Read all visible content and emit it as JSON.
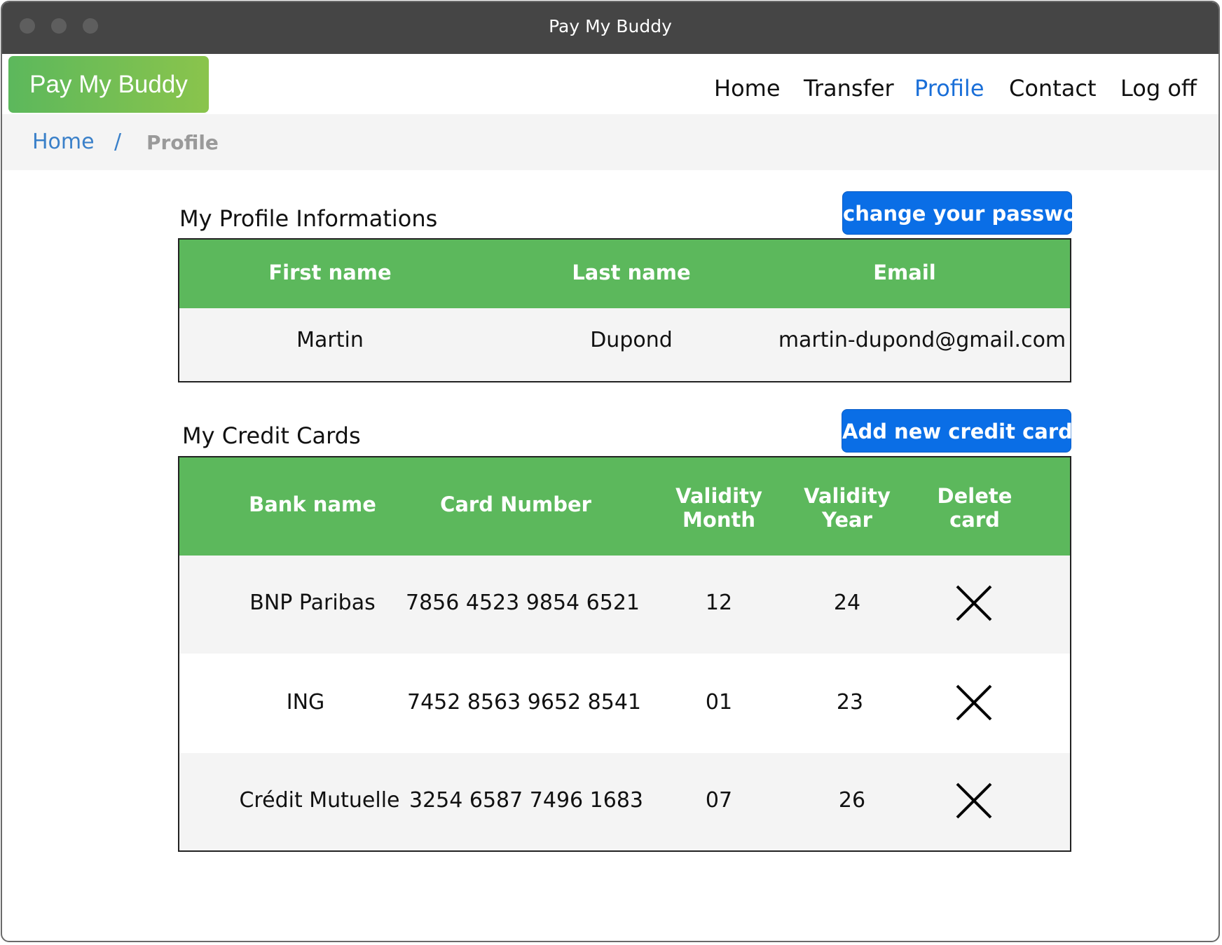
{
  "window": {
    "title": "Pay My Buddy"
  },
  "brand": {
    "label": "Pay My Buddy"
  },
  "nav": {
    "home": "Home",
    "transfer": "Transfer",
    "profile": "Profile",
    "contact": "Contact",
    "logoff": "Log off",
    "active": "Profile",
    "active_color": "#1a6fd8"
  },
  "breadcrumb": {
    "home": "Home",
    "separator": "/",
    "current": "Profile"
  },
  "profile": {
    "title": "My Profile Informations",
    "change_password_label": "change your password",
    "headers": {
      "first_name": "First name",
      "last_name": "Last name",
      "email": "Email"
    },
    "row": {
      "first_name": "Martin",
      "last_name": "Dupond",
      "email": "martin-dupond@gmail.com"
    }
  },
  "cards": {
    "title": "My Credit Cards",
    "add_label": "Add new credit card",
    "headers": {
      "bank_name": "Bank name",
      "card_number": "Card Number",
      "validity_month_1": "Validity",
      "validity_month_2": "Month",
      "validity_year_1": "Validity",
      "validity_year_2": "Year",
      "delete_1": "Delete",
      "delete_2": "card"
    },
    "rows": [
      {
        "bank": "BNP Paribas",
        "number": "7856 4523 9854 6521",
        "month": "12",
        "year": "24",
        "delete_icon": "close-x"
      },
      {
        "bank": "ING",
        "number": "7452 8563 9652 8541",
        "month": "01",
        "year": "23",
        "delete_icon": "close-x"
      },
      {
        "bank": "Crédit Mutuelle",
        "number": "3254 6587 7496 1683",
        "month": "07",
        "year": "26",
        "delete_icon": "close-x"
      }
    ]
  },
  "colors": {
    "header_green": "#5cb85c",
    "button_blue": "#0a6ee6",
    "titlebar": "#454545",
    "link_blue": "#3a80c9"
  }
}
